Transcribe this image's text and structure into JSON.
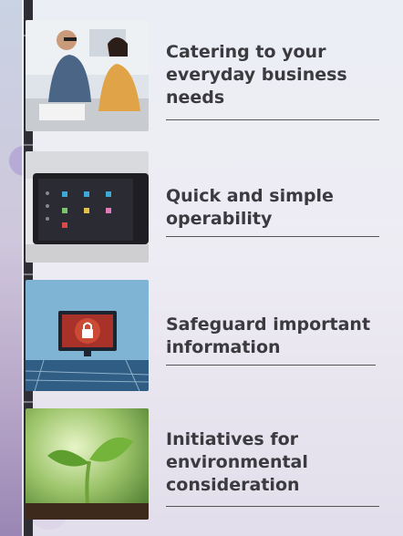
{
  "items": [
    {
      "title": "Catering to your everyday business needs",
      "image": "office-meeting-photo"
    },
    {
      "title": "Quick and simple operability",
      "image": "printer-touch-panel-photo"
    },
    {
      "title": "Safeguard important information",
      "image": "security-lock-screen-photo"
    },
    {
      "title": "Initiatives for environmental consideration",
      "image": "seedling-sprout-photo"
    }
  ],
  "colors": {
    "text": "#3a3a3f",
    "panel": "#f6f6fa",
    "rule": "#555555"
  }
}
